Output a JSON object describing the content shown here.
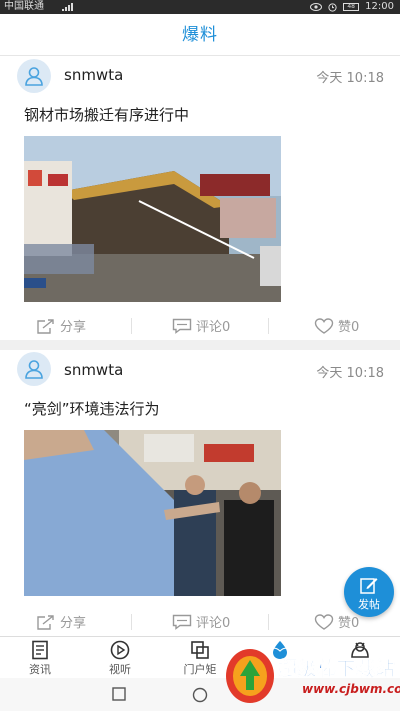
{
  "status_bar": {
    "carrier": "中国联通",
    "time": "12:00",
    "battery": "48"
  },
  "header": {
    "title": "爆料"
  },
  "posts": [
    {
      "username": "snmwta",
      "time": "今天  10:18",
      "title": "钢材市场搬迁有序进行中",
      "share_label": "分享",
      "comment_label": "评论0",
      "like_label": "赞0"
    },
    {
      "username": "snmwta",
      "time": "今天  10:18",
      "title": "“亮剑”环境违法行为",
      "share_label": "分享",
      "comment_label": "评论0",
      "like_label": "赞0"
    }
  ],
  "fab": {
    "label": "发帖"
  },
  "tabs": [
    {
      "label": "资讯",
      "icon": "news-icon"
    },
    {
      "label": "视听",
      "icon": "play-icon"
    },
    {
      "label": "门户矩",
      "icon": "portal-icon"
    },
    {
      "label": "",
      "icon": "drop-icon"
    },
    {
      "label": "",
      "icon": "mine-icon"
    }
  ],
  "watermark": {
    "title": "超级棒下载站",
    "url": "www.cjbwm.com"
  },
  "colors": {
    "accent": "#1e8fd8",
    "text_muted": "#8a8a8a"
  }
}
